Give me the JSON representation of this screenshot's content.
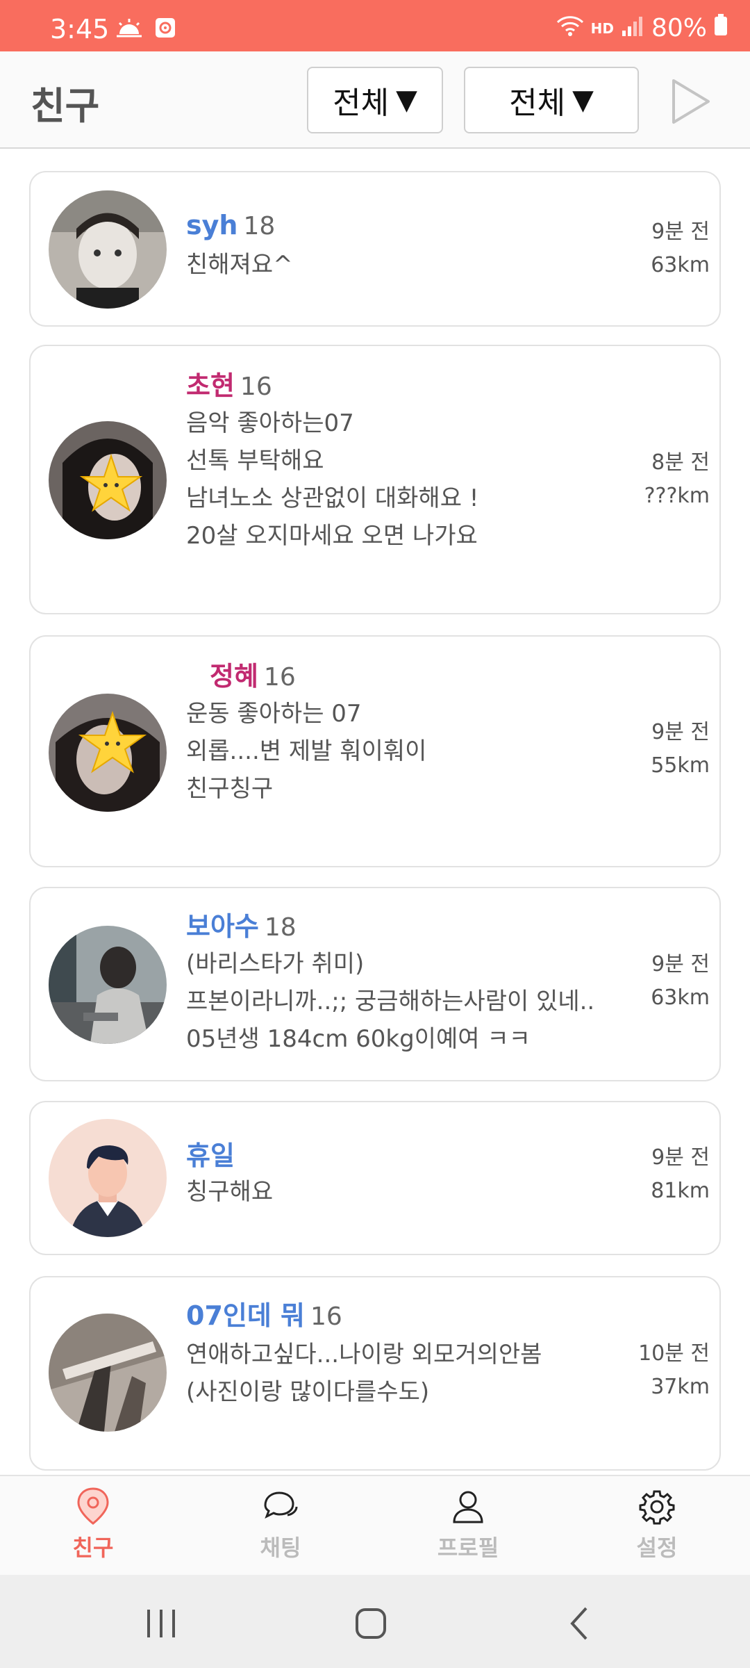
{
  "status_bar": {
    "time": "3:45",
    "battery": "80%",
    "network": "HD",
    "bg_color": "#f96d5e",
    "icons": [
      "weather-icon",
      "app-notification-icon",
      "wifi-icon",
      "hd-voice-icon",
      "signal-icon",
      "battery-icon"
    ]
  },
  "header": {
    "title": "친구",
    "filter_gender": "전체",
    "filter_age": "전체",
    "filter_arrow": "▼",
    "play_icon": "play-icon"
  },
  "friends": [
    {
      "name": "syh",
      "age": "18",
      "message": "친해져요^",
      "time": "9분 전",
      "distance": "63km",
      "name_color": "blue",
      "avatar": "photo-person"
    },
    {
      "name": "초현",
      "age": "16",
      "message": "음악 좋아하는07\n선톡 부탁해요\n남녀노소 상관없이 대화해요 !\n20살 오지마세요 오면 나가요",
      "time": "8분 전",
      "distance": "???km",
      "name_color": "pink",
      "avatar": "photo-star-sticker"
    },
    {
      "name": "정혜",
      "age": "16",
      "message": "운동 좋아하는 07\n외롭....변 제발 훠이훠이\n친구칭구",
      "time": "9분 전",
      "distance": "55km",
      "name_color": "pink",
      "avatar": "photo-star-sticker"
    },
    {
      "name": "보아수",
      "age": "18",
      "message": "(바리스타가 취미)\n프본이라니까..;; 궁금해하는사람이 있네..\n05년생 184cm 60kg이예여 ㅋㅋ",
      "time": "9분 전",
      "distance": "63km",
      "name_color": "blue",
      "avatar": "photo-person"
    },
    {
      "name": "휴일",
      "age": "",
      "message": "칭구해요",
      "time": "9분 전",
      "distance": "81km",
      "name_color": "blue",
      "avatar": "default-male-avatar"
    },
    {
      "name": "07인데 뭐",
      "age": "16",
      "message": "연애하고싶다...나이랑 외모거의안봄\n(사진이랑 많이다를수도)",
      "time": "10분 전",
      "distance": "37km",
      "name_color": "blue",
      "avatar": "photo"
    }
  ],
  "bottom_nav": [
    {
      "label": "친구",
      "icon": "location-pin-icon",
      "active": true
    },
    {
      "label": "채팅",
      "icon": "chat-bubbles-icon",
      "active": false
    },
    {
      "label": "프로필",
      "icon": "person-icon",
      "active": false
    },
    {
      "label": "설정",
      "icon": "gear-icon",
      "active": false
    }
  ],
  "colors": {
    "accent": "#f0655a",
    "name_blue": "#4a7fd6",
    "name_pink": "#c12a70"
  }
}
